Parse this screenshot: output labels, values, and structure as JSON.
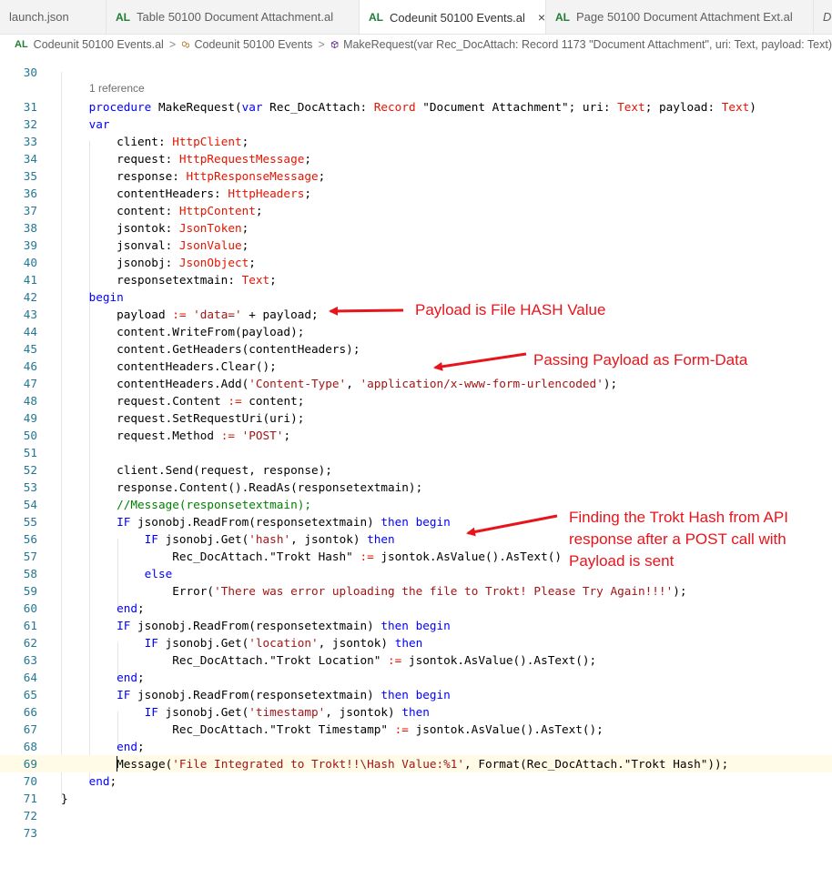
{
  "tabs": [
    {
      "icon": "",
      "label": "launch.json"
    },
    {
      "icon": "AL",
      "label": "Table 50100 Document Attachment.al"
    },
    {
      "icon": "AL",
      "label": "Codeunit 50100 Events.al",
      "close": "×"
    },
    {
      "icon": "AL",
      "label": "Page 50100 Document Attachment Ext.al"
    },
    {
      "icon": "",
      "label": "D"
    }
  ],
  "breadcrumb": {
    "icon": "AL",
    "file": "Codeunit 50100 Events.al",
    "object": "Codeunit 50100 Events",
    "method": "MakeRequest(var Rec_DocAttach: Record 1173 \"Document Attachment\", uri: Text, payload: Text)",
    "separator": ">"
  },
  "editor": {
    "reference_hint": "1 reference",
    "lines": [
      {
        "n": "30",
        "tokens": []
      },
      {
        "n": "31",
        "tokens": [
          [
            "    ",
            ""
          ],
          [
            "procedure",
            "k"
          ],
          [
            " MakeRequest(",
            ""
          ],
          [
            "var",
            "k"
          ],
          [
            " Rec_DocAttach: ",
            ""
          ],
          [
            "Record",
            "t"
          ],
          [
            " \"Document Attachment\"; uri: ",
            ""
          ],
          [
            "Text",
            "t"
          ],
          [
            "; payload: ",
            ""
          ],
          [
            "Text",
            "t"
          ],
          [
            ")",
            ""
          ]
        ]
      },
      {
        "n": "32",
        "tokens": [
          [
            "    ",
            ""
          ],
          [
            "var",
            "k"
          ]
        ]
      },
      {
        "n": "33",
        "tokens": [
          [
            "        client: ",
            ""
          ],
          [
            "HttpClient",
            "t"
          ],
          [
            ";",
            ""
          ]
        ]
      },
      {
        "n": "34",
        "tokens": [
          [
            "        request: ",
            ""
          ],
          [
            "HttpRequestMessage",
            "t"
          ],
          [
            ";",
            ""
          ]
        ]
      },
      {
        "n": "35",
        "tokens": [
          [
            "        response: ",
            ""
          ],
          [
            "HttpResponseMessage",
            "t"
          ],
          [
            ";",
            ""
          ]
        ]
      },
      {
        "n": "36",
        "tokens": [
          [
            "        contentHeaders: ",
            ""
          ],
          [
            "HttpHeaders",
            "t"
          ],
          [
            ";",
            ""
          ]
        ]
      },
      {
        "n": "37",
        "tokens": [
          [
            "        content: ",
            ""
          ],
          [
            "HttpContent",
            "t"
          ],
          [
            ";",
            ""
          ]
        ]
      },
      {
        "n": "38",
        "tokens": [
          [
            "        jsontok: ",
            ""
          ],
          [
            "JsonToken",
            "t"
          ],
          [
            ";",
            ""
          ]
        ]
      },
      {
        "n": "39",
        "tokens": [
          [
            "        jsonval: ",
            ""
          ],
          [
            "JsonValue",
            "t"
          ],
          [
            ";",
            ""
          ]
        ]
      },
      {
        "n": "40",
        "tokens": [
          [
            "        jsonobj: ",
            ""
          ],
          [
            "JsonObject",
            "t"
          ],
          [
            ";",
            ""
          ]
        ]
      },
      {
        "n": "41",
        "tokens": [
          [
            "        responsetextmain: ",
            ""
          ],
          [
            "Text",
            "t"
          ],
          [
            ";",
            ""
          ]
        ]
      },
      {
        "n": "42",
        "tokens": [
          [
            "    ",
            ""
          ],
          [
            "begin",
            "k"
          ]
        ]
      },
      {
        "n": "43",
        "tokens": [
          [
            "        payload ",
            ""
          ],
          [
            ":=",
            "t"
          ],
          [
            " ",
            ""
          ],
          [
            "'data='",
            "s"
          ],
          [
            " + payload;",
            ""
          ]
        ]
      },
      {
        "n": "44",
        "tokens": [
          [
            "        content.WriteFrom(payload);",
            ""
          ]
        ]
      },
      {
        "n": "45",
        "tokens": [
          [
            "        content.GetHeaders(contentHeaders);",
            ""
          ]
        ]
      },
      {
        "n": "46",
        "tokens": [
          [
            "        contentHeaders.Clear();",
            ""
          ]
        ]
      },
      {
        "n": "47",
        "tokens": [
          [
            "        contentHeaders.Add(",
            ""
          ],
          [
            "'Content-Type'",
            "s"
          ],
          [
            ", ",
            ""
          ],
          [
            "'application/x-www-form-urlencoded'",
            "s"
          ],
          [
            ");",
            ""
          ]
        ]
      },
      {
        "n": "48",
        "tokens": [
          [
            "        request.Content ",
            ""
          ],
          [
            ":=",
            "t"
          ],
          [
            " content;",
            ""
          ]
        ]
      },
      {
        "n": "49",
        "tokens": [
          [
            "        request.SetRequestUri(uri);",
            ""
          ]
        ]
      },
      {
        "n": "50",
        "tokens": [
          [
            "        request.Method ",
            ""
          ],
          [
            ":=",
            "t"
          ],
          [
            " ",
            ""
          ],
          [
            "'POST'",
            "s"
          ],
          [
            ";",
            ""
          ]
        ]
      },
      {
        "n": "51",
        "tokens": []
      },
      {
        "n": "52",
        "tokens": [
          [
            "        client.Send(request, response);",
            ""
          ]
        ]
      },
      {
        "n": "53",
        "tokens": [
          [
            "        response.Content().ReadAs(responsetextmain);",
            ""
          ]
        ]
      },
      {
        "n": "54",
        "tokens": [
          [
            "        //Message(responsetextmain);",
            "c"
          ]
        ]
      },
      {
        "n": "55",
        "tokens": [
          [
            "        ",
            ""
          ],
          [
            "IF",
            "k"
          ],
          [
            " jsonobj.ReadFrom(responsetextmain) ",
            ""
          ],
          [
            "then",
            "k"
          ],
          [
            " ",
            ""
          ],
          [
            "begin",
            "k"
          ]
        ]
      },
      {
        "n": "56",
        "tokens": [
          [
            "            ",
            ""
          ],
          [
            "IF",
            "k"
          ],
          [
            " jsonobj.Get(",
            ""
          ],
          [
            "'hash'",
            "s"
          ],
          [
            ", jsontok) ",
            ""
          ],
          [
            "then",
            "k"
          ]
        ]
      },
      {
        "n": "57",
        "tokens": [
          [
            "                Rec_DocAttach.\"Trokt Hash\" ",
            ""
          ],
          [
            ":=",
            "t"
          ],
          [
            " jsontok.AsValue().AsText()",
            ""
          ]
        ]
      },
      {
        "n": "58",
        "tokens": [
          [
            "            ",
            ""
          ],
          [
            "else",
            "k"
          ]
        ]
      },
      {
        "n": "59",
        "tokens": [
          [
            "                Error(",
            ""
          ],
          [
            "'There was error uploading the file to Trokt! Please Try Again!!!'",
            "s"
          ],
          [
            ");",
            ""
          ]
        ]
      },
      {
        "n": "60",
        "tokens": [
          [
            "        ",
            ""
          ],
          [
            "end",
            "k"
          ],
          [
            ";",
            ""
          ]
        ]
      },
      {
        "n": "61",
        "tokens": [
          [
            "        ",
            ""
          ],
          [
            "IF",
            "k"
          ],
          [
            " jsonobj.ReadFrom(responsetextmain) ",
            ""
          ],
          [
            "then",
            "k"
          ],
          [
            " ",
            ""
          ],
          [
            "begin",
            "k"
          ]
        ]
      },
      {
        "n": "62",
        "tokens": [
          [
            "            ",
            ""
          ],
          [
            "IF",
            "k"
          ],
          [
            " jsonobj.Get(",
            ""
          ],
          [
            "'location'",
            "s"
          ],
          [
            ", jsontok) ",
            ""
          ],
          [
            "then",
            "k"
          ]
        ]
      },
      {
        "n": "63",
        "tokens": [
          [
            "                Rec_DocAttach.\"Trokt Location\" ",
            ""
          ],
          [
            ":=",
            "t"
          ],
          [
            " jsontok.AsValue().AsText();",
            ""
          ]
        ]
      },
      {
        "n": "64",
        "tokens": [
          [
            "        ",
            ""
          ],
          [
            "end",
            "k"
          ],
          [
            ";",
            ""
          ]
        ]
      },
      {
        "n": "65",
        "tokens": [
          [
            "        ",
            ""
          ],
          [
            "IF",
            "k"
          ],
          [
            " jsonobj.ReadFrom(responsetextmain) ",
            ""
          ],
          [
            "then",
            "k"
          ],
          [
            " ",
            ""
          ],
          [
            "begin",
            "k"
          ]
        ]
      },
      {
        "n": "66",
        "tokens": [
          [
            "            ",
            ""
          ],
          [
            "IF",
            "k"
          ],
          [
            " jsonobj.Get(",
            ""
          ],
          [
            "'timestamp'",
            "s"
          ],
          [
            ", jsontok) ",
            ""
          ],
          [
            "then",
            "k"
          ]
        ]
      },
      {
        "n": "67",
        "tokens": [
          [
            "                Rec_DocAttach.\"Trokt Timestamp\" ",
            ""
          ],
          [
            ":=",
            "t"
          ],
          [
            " jsontok.AsValue().AsText();",
            ""
          ]
        ]
      },
      {
        "n": "68",
        "tokens": [
          [
            "        ",
            ""
          ],
          [
            "end",
            "k"
          ],
          [
            ";",
            ""
          ]
        ]
      },
      {
        "n": "69",
        "tokens": [
          [
            "        Message(",
            ""
          ],
          [
            "'File Integrated to Trokt!!\\Hash Value:%1'",
            "s"
          ],
          [
            ", Format(Rec_DocAttach.\"Trokt Hash\"));",
            ""
          ]
        ]
      },
      {
        "n": "70",
        "tokens": [
          [
            "    ",
            ""
          ],
          [
            "end",
            "k"
          ],
          [
            ";",
            ""
          ]
        ]
      },
      {
        "n": "71",
        "tokens": [
          [
            "}",
            ""
          ]
        ]
      },
      {
        "n": "72",
        "tokens": []
      },
      {
        "n": "73",
        "tokens": []
      }
    ]
  },
  "annotations": {
    "payload_note": "Payload is File HASH Value",
    "formdata_note": "Passing Payload as Form-Data",
    "hash_note_line1": "Finding the Trokt Hash from API",
    "hash_note_line2": "response after a POST call with",
    "hash_note_line3": "Payload is sent",
    "color": "#e8141b"
  },
  "colors": {
    "keyword": "#0000ff",
    "type": "#e51400",
    "string": "#a31515",
    "comment": "#008000",
    "line_number": "#237893",
    "al_icon": "#1e7e34"
  }
}
